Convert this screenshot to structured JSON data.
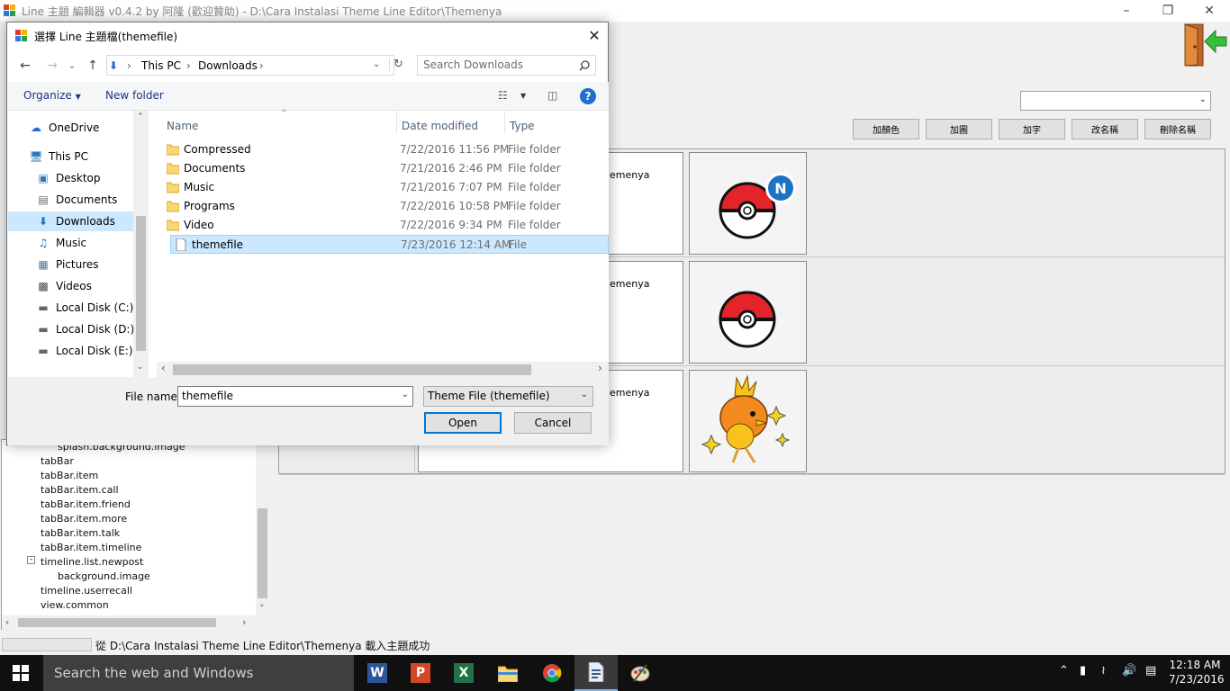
{
  "app": {
    "title": "Line 主題 編輯器 v0.4.2 by 阿隆 (歡迎贊助) - D:\\Cara Instalasi Theme Line Editor\\Themenya",
    "buttons": [
      "加顏色",
      "加圖",
      "加字",
      "改名稱",
      "刪除名稱"
    ],
    "theme_select_value": "",
    "rows": [
      {
        "text": "emenya",
        "image": "pokeball-new-icon"
      },
      {
        "text": "emenya",
        "image": "pokeball-icon"
      },
      {
        "text": "emenya",
        "image": "torchic-icon"
      }
    ],
    "tree_items": [
      "splash.background.image",
      "tabBar",
      "tabBar.item",
      "tabBar.item.call",
      "tabBar.item.friend",
      "tabBar.item.more",
      "tabBar.item.talk",
      "tabBar.item.timeline",
      "timeline.list.newpost",
      "background.image",
      "timeline.userrecall",
      "view.common"
    ],
    "status_text": "從 D:\\Cara Instalasi Theme Line Editor\\Themenya 載入主題成功"
  },
  "dialog": {
    "title": "選擇 Line 主題檔(themefile)",
    "breadcrumb": [
      "This PC",
      "Downloads"
    ],
    "search_placeholder": "Search Downloads",
    "toolbar": {
      "organize": "Organize",
      "new_folder": "New folder"
    },
    "nav": [
      {
        "label": "OneDrive",
        "icon": "onedrive-icon"
      },
      {
        "label": "This PC",
        "icon": "computer-icon"
      },
      {
        "label": "Desktop",
        "icon": "desktop-icon"
      },
      {
        "label": "Documents",
        "icon": "documents-icon"
      },
      {
        "label": "Downloads",
        "icon": "downloads-icon"
      },
      {
        "label": "Music",
        "icon": "music-icon"
      },
      {
        "label": "Pictures",
        "icon": "pictures-icon"
      },
      {
        "label": "Videos",
        "icon": "videos-icon"
      },
      {
        "label": "Local Disk (C:)",
        "icon": "drive-icon"
      },
      {
        "label": "Local Disk (D:)",
        "icon": "drive-icon"
      },
      {
        "label": "Local Disk (E:)",
        "icon": "drive-icon"
      }
    ],
    "columns": {
      "name": "Name",
      "date": "Date modified",
      "type": "Type"
    },
    "files": [
      {
        "name": "Compressed",
        "date": "7/22/2016 11:56 PM",
        "type": "File folder"
      },
      {
        "name": "Documents",
        "date": "7/21/2016 2:46 PM",
        "type": "File folder"
      },
      {
        "name": "Music",
        "date": "7/21/2016 7:07 PM",
        "type": "File folder"
      },
      {
        "name": "Programs",
        "date": "7/22/2016 10:58 PM",
        "type": "File folder"
      },
      {
        "name": "Video",
        "date": "7/22/2016 9:34 PM",
        "type": "File folder"
      },
      {
        "name": "themefile",
        "date": "7/23/2016 12:14 AM",
        "type": "File"
      }
    ],
    "file_name_label": "File name:",
    "file_name_value": "themefile",
    "filter": "Theme File (themefile)",
    "open": "Open",
    "cancel": "Cancel"
  },
  "taskbar": {
    "search": "Search the web and Windows",
    "time": "12:18 AM",
    "date": "7/23/2016"
  }
}
